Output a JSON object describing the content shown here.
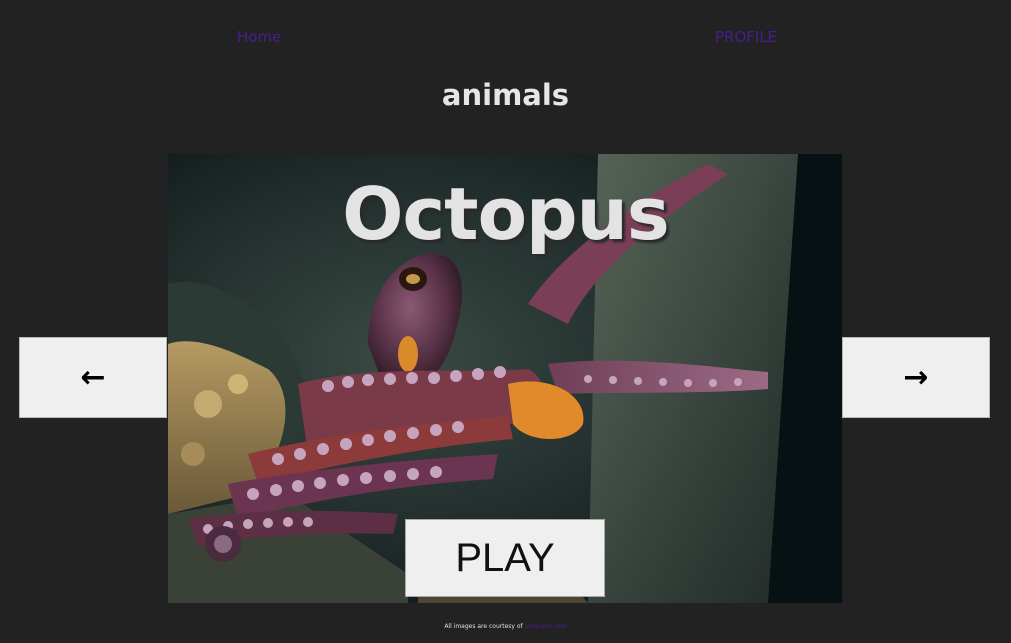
{
  "nav": {
    "home_label": "Home",
    "profile_label": "PROFILE"
  },
  "category": {
    "title": "animals"
  },
  "slide": {
    "animal_name": "Octopus",
    "image_icon": "octopus-photo"
  },
  "controls": {
    "prev_icon": "←",
    "next_icon": "→",
    "play_label": "PLAY"
  },
  "footer": {
    "credit_prefix": "All images are courtesy of",
    "credit_link": "Unsplash.com"
  },
  "colors": {
    "background": "#222222",
    "link": "#4a1d8f",
    "button": "#efefef"
  }
}
